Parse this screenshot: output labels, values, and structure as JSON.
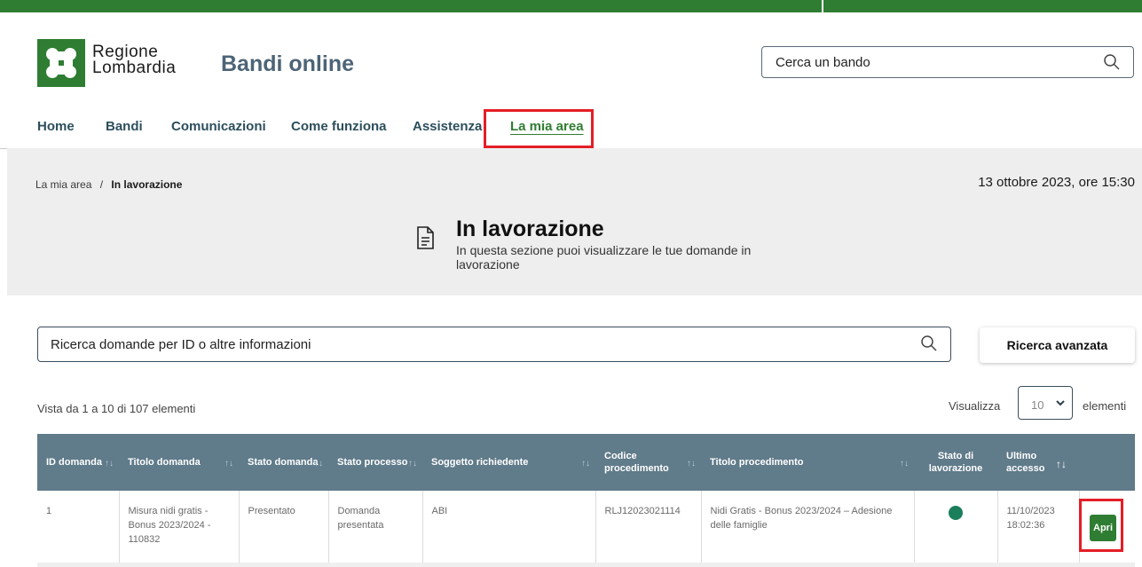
{
  "header": {
    "brand_line1": "Regione",
    "brand_line2": "Lombardia",
    "site_title": "Bandi online",
    "search_placeholder": "Cerca un bando"
  },
  "nav": {
    "items": [
      {
        "label": "Home"
      },
      {
        "label": "Bandi"
      },
      {
        "label": "Comunicazioni"
      },
      {
        "label": "Come funziona"
      },
      {
        "label": "Assistenza"
      },
      {
        "label": "La mia area",
        "active": true
      }
    ]
  },
  "breadcrumb": {
    "parent": "La mia area",
    "separator": "/",
    "current": "In lavorazione"
  },
  "datetime": "13 ottobre 2023, ore 15:30",
  "page": {
    "title": "In lavorazione",
    "subtitle": "In questa sezione puoi visualizzare le tue domande in lavorazione"
  },
  "search": {
    "placeholder": "Ricerca domande per ID o altre informazioni",
    "advanced_label": "Ricerca avanzata"
  },
  "list": {
    "count_text": "Vista da 1 a 10 di 107 elementi",
    "show_label": "Visualizza",
    "page_size": "10",
    "elements_label": "elementi"
  },
  "table": {
    "columns": [
      {
        "label": "ID domanda"
      },
      {
        "label": "Titolo domanda"
      },
      {
        "label": "Stato domanda"
      },
      {
        "label": "Stato processo"
      },
      {
        "label": "Soggetto richiedente"
      },
      {
        "label": "Codice procedimento"
      },
      {
        "label": "Titolo procedimento"
      },
      {
        "label": "Stato di lavorazione"
      },
      {
        "label": "Ultimo accesso"
      }
    ],
    "rows": [
      {
        "id": "1",
        "titolo_domanda": "Misura nidi gratis - Bonus 2023/2024 - 110832",
        "stato_domanda": "Presentato",
        "stato_processo": "Domanda presentata",
        "soggetto": "ABI",
        "codice": "RLJ12023021114",
        "titolo_procedimento": "Nidi Gratis - Bonus 2023/2024 – Adesione delle famiglie",
        "ultimo_accesso": "11/10/2023 18:02:36",
        "action_label": "Apri",
        "status_color": "#1b7f5b"
      }
    ]
  },
  "colors": {
    "brand_green": "#2f7d32",
    "header_blue": "#607b8a",
    "highlight_red": "#e41e26",
    "title_blue": "#4c6476"
  }
}
